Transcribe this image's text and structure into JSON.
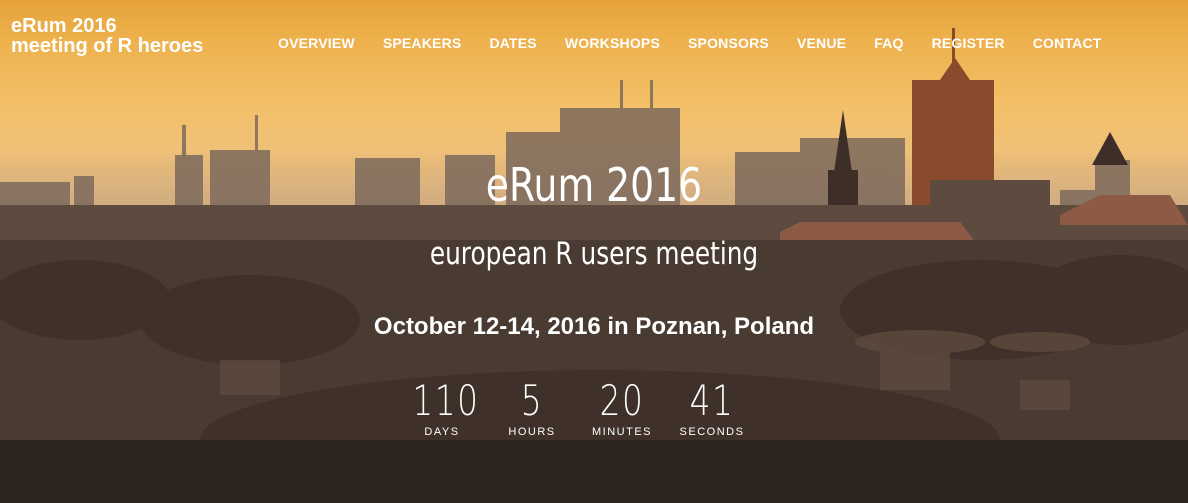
{
  "brand": {
    "line1": "eRum 2016",
    "line2": "meeting of R heroes"
  },
  "nav": [
    {
      "label": "OVERVIEW"
    },
    {
      "label": "SPEAKERS"
    },
    {
      "label": "DATES"
    },
    {
      "label": "WORKSHOPS"
    },
    {
      "label": "SPONSORS"
    },
    {
      "label": "VENUE"
    },
    {
      "label": "FAQ"
    },
    {
      "label": "REGISTER"
    },
    {
      "label": "CONTACT"
    }
  ],
  "hero": {
    "title": "eRum 2016",
    "subtitle": "european R users meeting",
    "date_location": "October 12-14, 2016 in Poznan, Poland"
  },
  "countdown": [
    {
      "value": "110",
      "label": "DAYS"
    },
    {
      "value": "5",
      "label": "HOURS"
    },
    {
      "value": "20",
      "label": "MINUTES"
    },
    {
      "value": "41",
      "label": "SECONDS"
    }
  ],
  "colors": {
    "sky_top": "#e6a33a",
    "sky_mid": "#f3c06a",
    "ground": "#3c3028",
    "text": "#ffffff"
  }
}
